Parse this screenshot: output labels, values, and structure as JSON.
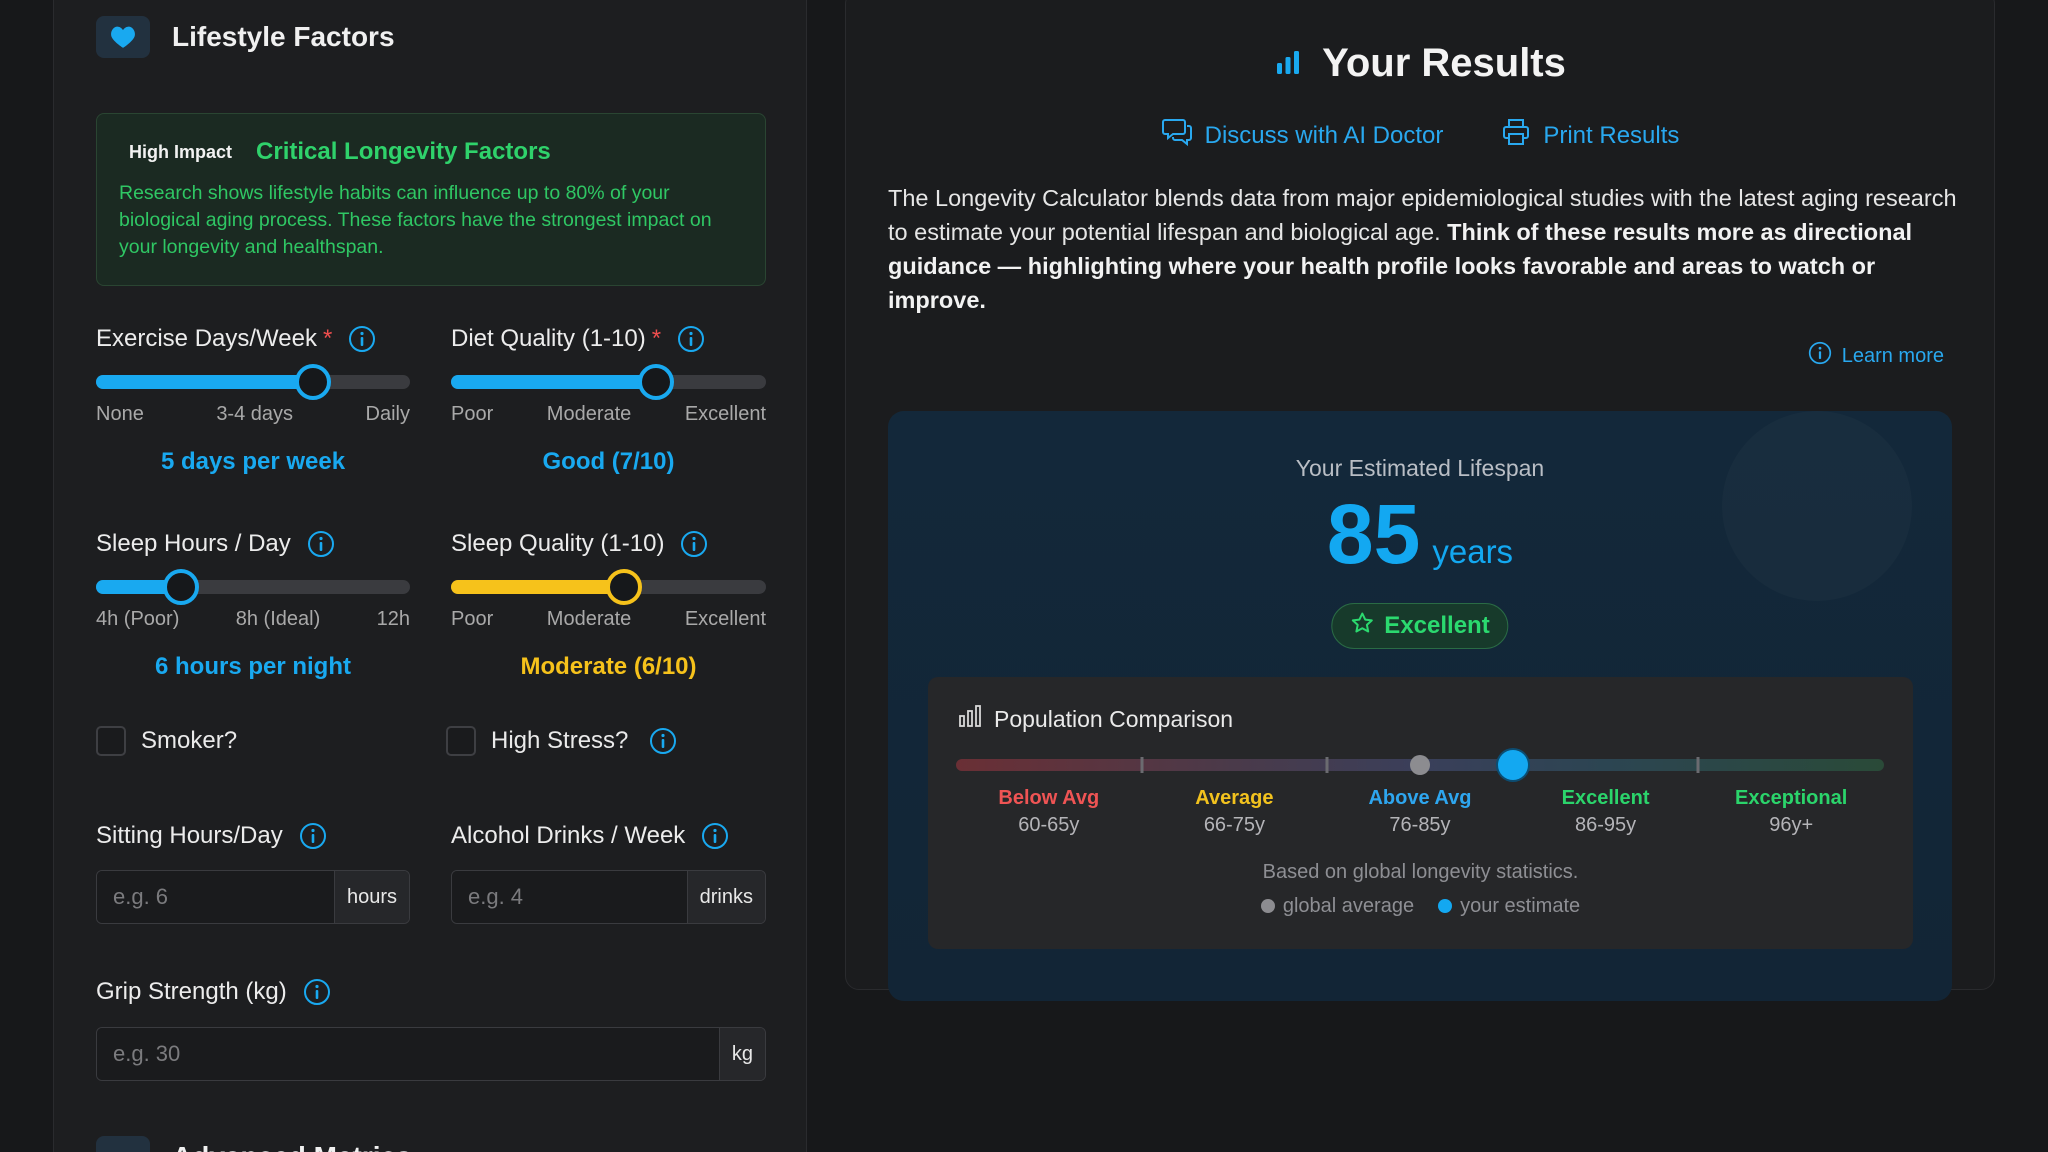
{
  "lifestyle": {
    "title": "Lifestyle Factors",
    "impact": {
      "badge": "High Impact",
      "title": "Critical Longevity Factors",
      "text": "Research shows lifestyle habits can influence up to 80% of your biological aging process. These factors have the strongest impact on your longevity and healthspan."
    },
    "exercise": {
      "label": "Exercise Days/Week",
      "required": "*",
      "ticks": [
        "None",
        "3-4 days",
        "Daily"
      ],
      "value_text": "5 days per week",
      "level": 0.69
    },
    "diet": {
      "label": "Diet Quality (1-10)",
      "required": "*",
      "ticks": [
        "Poor",
        "Moderate",
        "Excellent"
      ],
      "value_text": "Good (7/10)",
      "level": 0.65
    },
    "sleep_hours": {
      "label": "Sleep Hours / Day",
      "ticks": [
        "4h (Poor)",
        "8h (Ideal)",
        "12h"
      ],
      "value_text": "6 hours per night",
      "level": 0.27
    },
    "sleep_quality": {
      "label": "Sleep Quality (1-10)",
      "ticks": [
        "Poor",
        "Moderate",
        "Excellent"
      ],
      "value_text": "Moderate (6/10)",
      "level": 0.55
    },
    "smoker": {
      "label": "Smoker?"
    },
    "high_stress": {
      "label": "High Stress?"
    },
    "sitting": {
      "label": "Sitting Hours/Day",
      "placeholder": "e.g. 6",
      "unit": "hours"
    },
    "alcohol": {
      "label": "Alcohol Drinks / Week",
      "placeholder": "e.g. 4",
      "unit": "drinks"
    },
    "grip": {
      "label": "Grip Strength (kg)",
      "placeholder": "e.g. 30",
      "unit": "kg"
    },
    "advanced_title": "Advanced Metrics"
  },
  "results": {
    "title": "Your Results",
    "discuss": "Discuss with AI Doctor",
    "print": "Print Results",
    "description_plain": "The Longevity Calculator blends data from major epidemiological studies with the latest aging research to estimate your potential lifespan and biological age. ",
    "description_bold": "Think of these results more as directional guidance — highlighting where your health profile looks favorable and areas to watch or improve.",
    "learn_more": "Learn more",
    "estimate": {
      "label": "Your Estimated Lifespan",
      "value": "85",
      "unit": "years",
      "rating": "Excellent"
    },
    "population": {
      "title": "Population Comparison",
      "categories": [
        {
          "name": "Below Avg",
          "range": "60-65y",
          "color": "#ef5454"
        },
        {
          "name": "Average",
          "range": "66-75y",
          "color": "#f2c21e"
        },
        {
          "name": "Above Avg",
          "range": "76-85y",
          "color": "#2ea6ef"
        },
        {
          "name": "Excellent",
          "range": "86-95y",
          "color": "#2bd46b"
        },
        {
          "name": "Exceptional",
          "range": "96y+",
          "color": "#2bd46b"
        }
      ],
      "global_average_position": 0.5,
      "your_estimate_position": 0.6,
      "note": "Based on global longevity statistics.",
      "legend_global": "global average",
      "legend_estimate": "your estimate"
    }
  },
  "colors": {
    "accent": "#19a9f0",
    "yellow": "#f6c21b",
    "green": "#2fd26b",
    "bg": "#17181a"
  }
}
